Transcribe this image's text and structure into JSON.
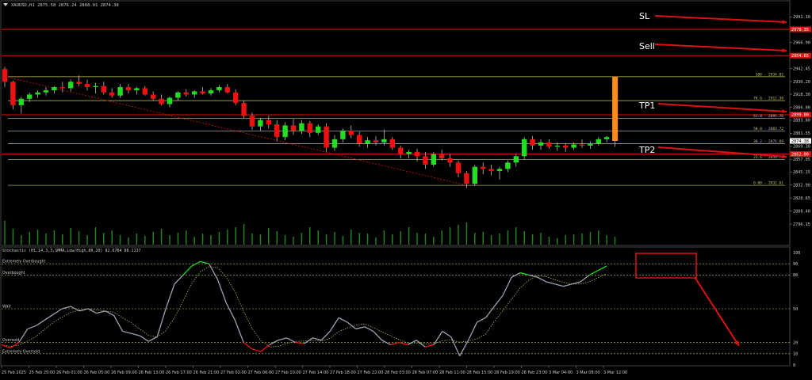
{
  "window": {
    "symbol_header": "XAUUSD,H1  2875.58 2876.24 2868.91 2874.38"
  },
  "annotations": {
    "sl": "SL",
    "sell": "Sell",
    "tp1": "TP1",
    "tp2": "TP2"
  },
  "colors": {
    "background": "#000000",
    "bull": "#22dd22",
    "bear": "#ee1111",
    "fib": "#c8c86a",
    "annotation": "#dd1111",
    "highlight": "#ff8c1a",
    "stoch_main": "#9aa4b0",
    "stoch_signal": "#c8c86a",
    "volume": "#1e8a1e"
  },
  "price_axis": {
    "min": 2785,
    "max": 3001,
    "ticks": [
      "2991.10",
      "2979.35",
      "2966.90",
      "2954.65",
      "2942.45",
      "2930.20",
      "2918.30",
      "2906.00",
      "2893.80",
      "2881.55",
      "2869.30",
      "2857.05",
      "2845.15",
      "2832.90",
      "2820.65",
      "2808.40",
      "2796.15"
    ],
    "marker_values": [
      "2979.35",
      "2954.65",
      "2899.00",
      "2874.38",
      "2862.00"
    ]
  },
  "fib_levels": [
    {
      "label": "100 - 2934.82",
      "value": 2934.82
    },
    {
      "label": "78.6 - 2912.30",
      "value": 2912.3
    },
    {
      "label": "61.8 - 2895.76",
      "value": 2895.76
    },
    {
      "label": "50.0 - 2883.72",
      "value": 2883.72
    },
    {
      "label": "38.2 - 2871.69",
      "value": 2871.69
    },
    {
      "label": "23.6 - 2856.75",
      "value": 2856.75
    },
    {
      "label": "0.00 - 2832.61",
      "value": 2832.61
    }
  ],
  "hlines": [
    {
      "name": "sl-level",
      "value": 2979.35
    },
    {
      "name": "sell-level",
      "value": 2954.65
    },
    {
      "name": "tp1-level",
      "value": 2899.0
    },
    {
      "name": "tp2-level",
      "value": 2862.0
    }
  ],
  "time_axis": {
    "labels": [
      "25 Feb 2025",
      "25 Feb 20:00",
      "26 Feb 01:00",
      "26 Feb 05:00",
      "26 Feb 09:00",
      "26 Feb 13:00",
      "26 Feb 17:00",
      "26 Feb 21:00",
      "27 Feb 02:00",
      "27 Feb 06:00",
      "27 Feb 10:00",
      "27 Feb 14:00",
      "27 Feb 18:00",
      "27 Feb 22:00",
      "28 Feb 03:00",
      "28 Feb 07:00",
      "28 Feb 11:00",
      "28 Feb 15:00",
      "28 Feb 19:00",
      "28 Feb 23:00",
      "3 Mar 04:00",
      "3 Mar 08:00",
      "3 Mar 12:00"
    ]
  },
  "stochastic": {
    "header": "Stochastic (H1,14,3,3,SMMA,Low/High,80,20) 82.6784 88.1137",
    "levels": [
      {
        "label": "Extremely Overbought",
        "value": 90
      },
      {
        "label": "Overbought",
        "value": 80
      },
      {
        "label": "Wait",
        "value": 50
      },
      {
        "label": "Oversold",
        "value": 20
      },
      {
        "label": "Extremely Oversold",
        "value": 10
      }
    ],
    "axis_ticks": [
      "100",
      "90",
      "80",
      "50",
      "20",
      "10",
      "0"
    ]
  },
  "chart_data": {
    "type": "candlestick",
    "candles": [
      [
        2942,
        2944,
        2925,
        2930
      ],
      [
        2930,
        2931,
        2904,
        2908
      ],
      [
        2908,
        2916,
        2900,
        2914
      ],
      [
        2914,
        2920,
        2911,
        2918
      ],
      [
        2918,
        2922,
        2915,
        2920
      ],
      [
        2920,
        2925,
        2917,
        2922
      ],
      [
        2922,
        2926,
        2919,
        2925
      ],
      [
        2925,
        2930,
        2920,
        2924
      ],
      [
        2924,
        2932,
        2921,
        2930
      ],
      [
        2930,
        2936,
        2926,
        2928
      ],
      [
        2928,
        2932,
        2922,
        2925
      ],
      [
        2925,
        2929,
        2919,
        2926
      ],
      [
        2926,
        2930,
        2918,
        2920
      ],
      [
        2920,
        2924,
        2915,
        2917
      ],
      [
        2917,
        2928,
        2915,
        2925
      ],
      [
        2925,
        2928,
        2919,
        2922
      ],
      [
        2922,
        2925,
        2918,
        2924
      ],
      [
        2924,
        2926,
        2917,
        2918
      ],
      [
        2918,
        2921,
        2912,
        2914
      ],
      [
        2914,
        2918,
        2908,
        2909
      ],
      [
        2909,
        2916,
        2906,
        2915
      ],
      [
        2915,
        2921,
        2912,
        2920
      ],
      [
        2920,
        2923,
        2916,
        2918
      ],
      [
        2918,
        2922,
        2915,
        2921
      ],
      [
        2921,
        2925,
        2918,
        2919
      ],
      [
        2919,
        2924,
        2917,
        2922
      ],
      [
        2922,
        2927,
        2920,
        2925
      ],
      [
        2925,
        2928,
        2919,
        2920
      ],
      [
        2920,
        2923,
        2908,
        2910
      ],
      [
        2910,
        2912,
        2896,
        2898
      ],
      [
        2898,
        2901,
        2885,
        2888
      ],
      [
        2888,
        2896,
        2884,
        2894
      ],
      [
        2894,
        2898,
        2886,
        2890
      ],
      [
        2890,
        2894,
        2874,
        2878
      ],
      [
        2878,
        2892,
        2875,
        2889
      ],
      [
        2889,
        2895,
        2880,
        2884
      ],
      [
        2884,
        2894,
        2881,
        2891
      ],
      [
        2891,
        2893,
        2878,
        2882
      ],
      [
        2882,
        2890,
        2880,
        2888
      ],
      [
        2888,
        2891,
        2864,
        2868
      ],
      [
        2868,
        2880,
        2865,
        2876
      ],
      [
        2876,
        2886,
        2873,
        2884
      ],
      [
        2884,
        2889,
        2877,
        2880
      ],
      [
        2880,
        2883,
        2869,
        2872
      ],
      [
        2872,
        2878,
        2868,
        2875
      ],
      [
        2875,
        2879,
        2870,
        2873
      ],
      [
        2873,
        2885,
        2870,
        2876
      ],
      [
        2876,
        2878,
        2866,
        2868
      ],
      [
        2868,
        2870,
        2858,
        2862
      ],
      [
        2862,
        2866,
        2858,
        2864
      ],
      [
        2864,
        2867,
        2855,
        2860
      ],
      [
        2860,
        2864,
        2848,
        2852
      ],
      [
        2852,
        2864,
        2850,
        2862
      ],
      [
        2862,
        2866,
        2856,
        2858
      ],
      [
        2858,
        2862,
        2850,
        2854
      ],
      [
        2854,
        2856,
        2840,
        2844
      ],
      [
        2844,
        2846,
        2830,
        2834
      ],
      [
        2834,
        2852,
        2832,
        2850
      ],
      [
        2850,
        2854,
        2843,
        2848
      ],
      [
        2848,
        2852,
        2842,
        2846
      ],
      [
        2846,
        2850,
        2838,
        2848
      ],
      [
        2848,
        2856,
        2845,
        2854
      ],
      [
        2854,
        2862,
        2850,
        2860
      ],
      [
        2860,
        2878,
        2857,
        2876
      ],
      [
        2876,
        2879,
        2866,
        2870
      ],
      [
        2870,
        2876,
        2866,
        2873
      ],
      [
        2873,
        2876,
        2867,
        2869
      ],
      [
        2869,
        2873,
        2865,
        2870
      ],
      [
        2870,
        2872,
        2864,
        2868
      ],
      [
        2868,
        2873,
        2866,
        2871
      ],
      [
        2871,
        2876,
        2868,
        2870
      ],
      [
        2870,
        2874,
        2867,
        2872
      ],
      [
        2872,
        2878,
        2870,
        2876
      ],
      [
        2876,
        2879,
        2873,
        2878
      ],
      [
        2875.58,
        2876.24,
        2868.91,
        2874.38
      ]
    ],
    "volume": [
      30,
      20,
      12,
      16,
      19,
      14,
      18,
      13,
      21,
      17,
      12,
      22,
      15,
      18,
      12,
      9,
      14,
      11,
      16,
      20,
      12,
      15,
      18,
      10,
      14,
      12,
      16,
      19,
      22,
      26,
      14,
      13,
      21,
      17,
      12,
      10,
      15,
      22,
      18,
      13,
      16,
      11,
      19,
      15,
      14,
      9,
      18,
      13,
      17,
      22,
      15,
      14,
      10,
      18,
      22,
      25,
      28,
      15,
      16,
      12,
      14,
      18,
      22,
      17,
      13,
      15,
      10,
      8,
      12,
      13,
      14,
      16,
      18,
      12,
      10
    ],
    "stoch_main": [
      18,
      15,
      20,
      32,
      35,
      40,
      45,
      50,
      52,
      48,
      50,
      46,
      48,
      44,
      30,
      28,
      26,
      21,
      25,
      50,
      72,
      80,
      88,
      92,
      90,
      76,
      55,
      40,
      20,
      14,
      12,
      18,
      22,
      24,
      20,
      19,
      24,
      22,
      30,
      42,
      38,
      32,
      34,
      30,
      22,
      18,
      20,
      18,
      22,
      16,
      18,
      30,
      25,
      8,
      22,
      38,
      42,
      52,
      62,
      78,
      82,
      80,
      78,
      74,
      72,
      70,
      72,
      74,
      80,
      84,
      88
    ]
  },
  "indicator_box": {
    "label": ""
  }
}
